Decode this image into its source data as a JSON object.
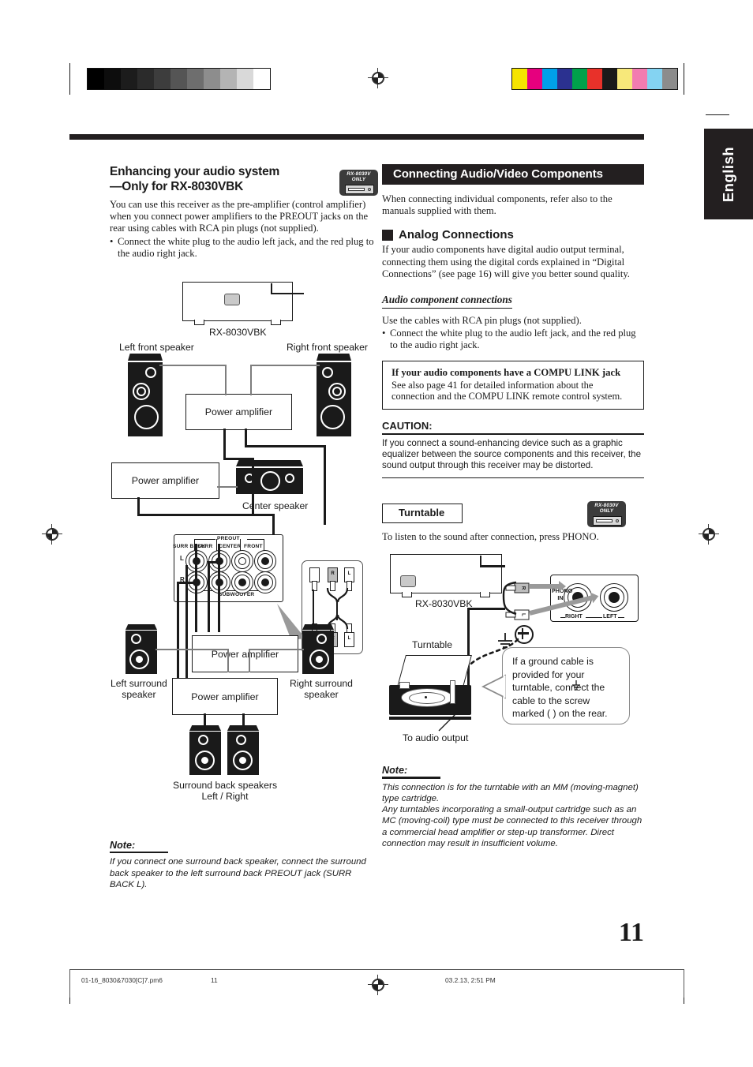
{
  "page": {
    "language_tab": "English",
    "page_number": "11"
  },
  "printmarks": {
    "gray_steps": [
      "#000000",
      "#0d0d0d",
      "#1c1c1c",
      "#2b2b2b",
      "#3d3d3d",
      "#555555",
      "#6e6e6e",
      "#8d8d8d",
      "#b4b4b4",
      "#d9d9d9",
      "#ffffff"
    ],
    "color_steps": [
      "#f5e400",
      "#e6007e",
      "#00a0e9",
      "#2b3190",
      "#00a14b",
      "#e8312a",
      "#1a1a1a",
      "#f7e87a",
      "#f27cb0",
      "#84d3f2",
      "#8c8c8c"
    ]
  },
  "left_column": {
    "heading_line1": "Enhancing your audio system",
    "heading_line2": "—Only for RX-8030VBK",
    "badge": {
      "line1": "RX-8030V",
      "line2": "ONLY"
    },
    "paragraph": "You can use this receiver as the pre-amplifier (control amplifier) when you connect power amplifiers to the PREOUT jacks on the rear using cables with RCA pin plugs (not supplied).",
    "bullets": [
      "Connect the white plug to the audio left jack, and the red plug to the audio right jack."
    ],
    "note_heading": "Note:",
    "note_body": "If you connect one surround back speaker, connect the surround back speaker to the left surround back PREOUT jack (SURR BACK L)."
  },
  "left_diagram": {
    "receiver_label": "RX-8030VBK",
    "left_front_speaker": "Left front speaker",
    "right_front_speaker": "Right front speaker",
    "center_speaker": "Center speaker",
    "left_surround_speaker_l1": "Left surround",
    "left_surround_speaker_l2": "speaker",
    "right_surround_speaker_l1": "Right surround",
    "right_surround_speaker_l2": "speaker",
    "surround_back_l1": "Surround back speakers",
    "surround_back_l2": "Left  /  Right",
    "power_amplifier": "Power amplifier",
    "preout": {
      "title": "PREOUT",
      "groups": [
        "SURR BACK",
        "SURR",
        "CENTER",
        "FRONT"
      ],
      "subwoofer": "SUBWOOFER",
      "row_left": "L",
      "row_right": "R",
      "front_left": "L",
      "front_right": "R"
    },
    "plug_labels": {
      "right": "R",
      "left": "L"
    }
  },
  "right_column": {
    "section_title": "Connecting Audio/Video Components",
    "intro": "When connecting individual components, refer also to the manuals supplied with them.",
    "analog_heading": "Analog Connections",
    "analog_body": "If your audio components have digital audio output terminal, connecting them using the digital cords explained in “Digital Connections” (see page 16) will give you better sound quality.",
    "subheading": "Audio component connections",
    "sub_body": "Use the cables with RCA pin plugs (not supplied).",
    "sub_bullets": [
      "Connect the white plug to the audio left jack, and the red plug to the audio right jack."
    ],
    "compu_box": {
      "title": "If your audio components have a COMPU LINK jack",
      "body": "See also page 41 for detailed information about the connection and the COMPU LINK remote control system."
    },
    "caution_title": "CAUTION:",
    "caution_body": "If you connect a sound-enhancing device such as a graphic equalizer between the source components and this receiver, the sound output through this receiver may be distorted.",
    "turntable_label": "Turntable",
    "badge": {
      "line1": "RX-8030V",
      "line2": "ONLY"
    },
    "turntable_intro": "To listen to the sound after connection, press PHONO.",
    "note_heading": "Note:",
    "note_body_1": "This connection is for the turntable with an MM (moving-magnet) type cartridge.",
    "note_body_2": "Any turntables incorporating a small-output cartridge such as an MC (moving-coil) type must be connected to this receiver through a commercial head amplifier or step-up transformer. Direct connection may result in insufficient volume."
  },
  "right_diagram": {
    "receiver_label": "RX-8030VBK",
    "turntable_label": "Turntable",
    "audio_output_label": "To audio output",
    "phono": {
      "line1": "PHONO",
      "line2": "IN",
      "right": "RIGHT",
      "left": "LEFT"
    },
    "plug_labels": {
      "right": "R",
      "left": "L"
    },
    "callout": "If a ground cable is provided for your turntable, connect the cable to the screw marked (    ) on the rear."
  },
  "footer": {
    "filename": "01-16_8030&7030[C]7.pm6",
    "page": "11",
    "timestamp": "03.2.13, 2:51 PM"
  }
}
